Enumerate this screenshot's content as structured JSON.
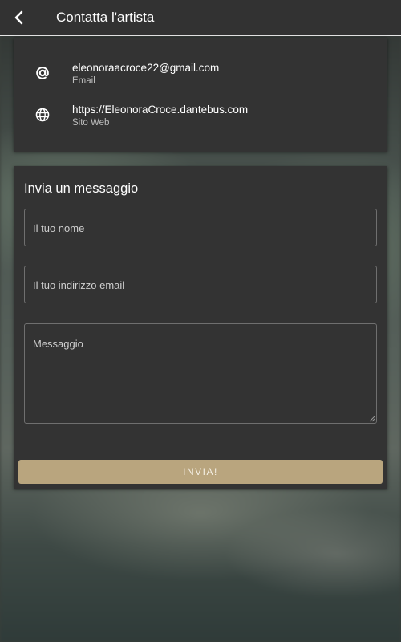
{
  "header": {
    "back_icon": "chevron-left-icon",
    "title": "Contatta l'artista"
  },
  "contacts": [
    {
      "icon": "at-icon",
      "value": "eleonoraacroce22@gmail.com",
      "label": "Email"
    },
    {
      "icon": "globe-icon",
      "value": "https://EleonoraCroce.dantebus.com",
      "label": "Sito Web"
    }
  ],
  "form": {
    "title": "Invia un messaggio",
    "name_placeholder": "Il tuo nome",
    "email_placeholder": "Il tuo indirizzo email",
    "message_placeholder": "Messaggio",
    "submit_label": "INVIA!"
  },
  "colors": {
    "topbar": "#323232",
    "card": "#333333",
    "accent_button": "#b9a57e"
  }
}
